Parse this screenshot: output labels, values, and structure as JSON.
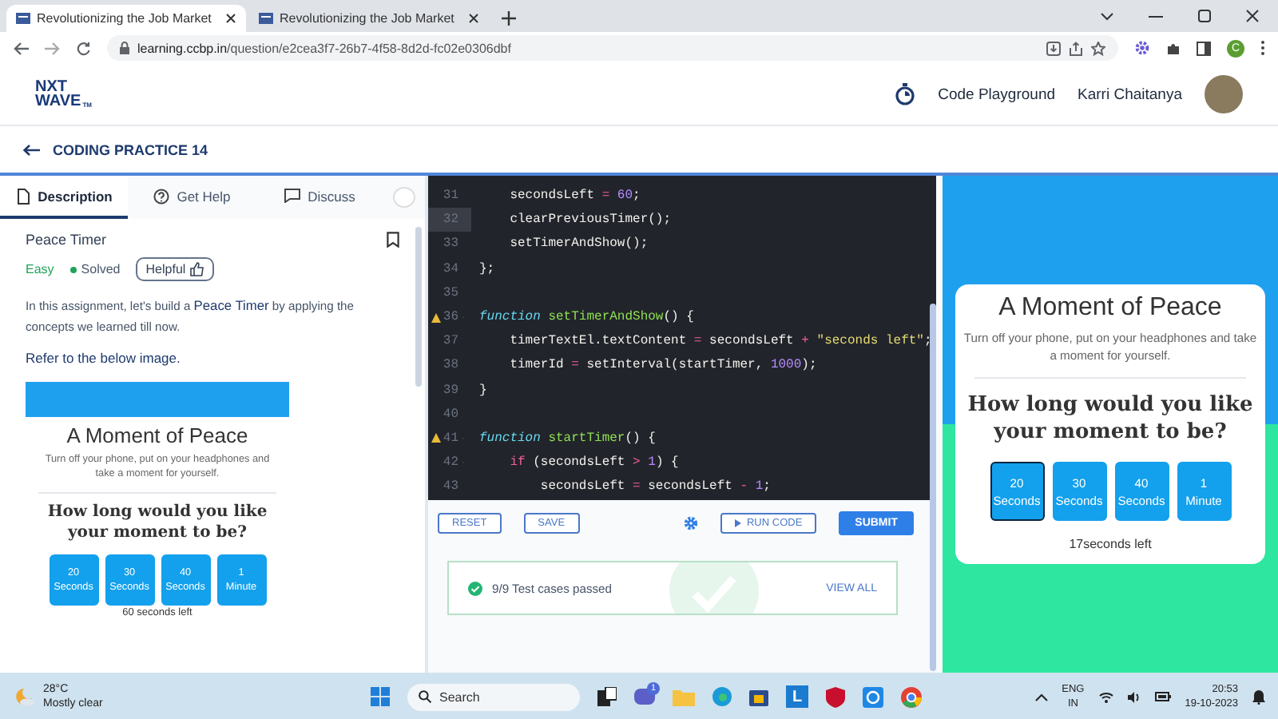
{
  "browser": {
    "tabs": [
      {
        "title": "Revolutionizing the Job Market",
        "selected": true
      },
      {
        "title": "Revolutionizing the Job Market",
        "selected": false
      }
    ],
    "url_host": "learning.ccbp.in",
    "url_path": "/question/e2cea3f7-26b7-4f58-8d2d-fc02e0306dbf",
    "profile_initial": "C"
  },
  "header": {
    "logo_top": "NXT",
    "logo_bottom": "WAVE",
    "logo_mark": "TM",
    "playground": "Code Playground",
    "user": "Karri Chaitanya"
  },
  "practice": {
    "title": "CODING PRACTICE 14"
  },
  "left_panel": {
    "tabs": [
      {
        "label": "Description",
        "selected": true
      },
      {
        "label": "Get Help",
        "selected": false
      },
      {
        "label": "Discuss",
        "selected": false
      }
    ],
    "problem": {
      "title": "Peace Timer",
      "difficulty": "Easy",
      "status": "Solved",
      "helpful": "Helpful"
    },
    "description": "In this assignment, let's build a **Peace Timer** by applying the concepts we learned till now.",
    "refer": "Refer to the below image.",
    "preview": {
      "title": "A Moment of Peace",
      "subtitle": "Turn off your phone, put on your headphones and take a moment for yourself.",
      "question": "How long would you like your moment to be?",
      "options": [
        {
          "value": "20",
          "unit": "Seconds",
          "selected": false
        },
        {
          "value": "30",
          "unit": "Seconds",
          "selected": false
        },
        {
          "value": "40",
          "unit": "Seconds",
          "selected": false
        },
        {
          "value": "1",
          "unit": "Minute",
          "selected": false
        }
      ],
      "timer": "60 seconds left"
    }
  },
  "editor": {
    "lines": [
      {
        "number": "31",
        "warning": false,
        "foldable": false,
        "highlighted": false,
        "tokens": [
          {
            "kind": "plain",
            "text": "    secondsLeft "
          },
          {
            "kind": "op",
            "text": "="
          },
          {
            "kind": "num",
            "text": " 60"
          },
          {
            "kind": "plain",
            "text": ";"
          }
        ]
      },
      {
        "number": "32",
        "warning": false,
        "foldable": false,
        "highlighted": true,
        "tokens": [
          {
            "kind": "plain",
            "text": "    clearPreviousTimer();"
          }
        ]
      },
      {
        "number": "33",
        "warning": false,
        "foldable": false,
        "highlighted": false,
        "tokens": [
          {
            "kind": "plain",
            "text": "    setTimerAndShow();"
          }
        ]
      },
      {
        "number": "34",
        "warning": false,
        "foldable": false,
        "highlighted": false,
        "tokens": [
          {
            "kind": "plain",
            "text": "};"
          }
        ]
      },
      {
        "number": "35",
        "warning": false,
        "foldable": false,
        "highlighted": false
      },
      {
        "number": "36",
        "warning": true,
        "foldable": true,
        "highlighted": false,
        "tokens": [
          {
            "kind": "kw",
            "text": "function"
          },
          {
            "kind": "fn",
            "text": " setTimerAndShow"
          },
          {
            "kind": "plain",
            "text": "() {"
          }
        ]
      },
      {
        "number": "37",
        "warning": false,
        "foldable": false,
        "highlighted": false,
        "tokens": [
          {
            "kind": "plain",
            "text": "    timerTextEl.textContent "
          },
          {
            "kind": "op",
            "text": "="
          },
          {
            "kind": "plain",
            "text": " secondsLeft "
          },
          {
            "kind": "op",
            "text": "+"
          },
          {
            "kind": "str",
            "text": " \"seconds left\""
          },
          {
            "kind": "plain",
            "text": ";"
          }
        ]
      },
      {
        "number": "38",
        "warning": false,
        "foldable": false,
        "highlighted": false,
        "tokens": [
          {
            "kind": "plain",
            "text": "    timerId "
          },
          {
            "kind": "op",
            "text": "="
          },
          {
            "kind": "plain",
            "text": " setInterval(startTimer, "
          },
          {
            "kind": "num",
            "text": "1000"
          },
          {
            "kind": "plain",
            "text": ");"
          }
        ]
      },
      {
        "number": "39",
        "warning": false,
        "foldable": false,
        "highlighted": false,
        "tokens": [
          {
            "kind": "plain",
            "text": "}"
          }
        ]
      },
      {
        "number": "40",
        "warning": false,
        "foldable": false,
        "highlighted": false
      },
      {
        "number": "41",
        "warning": true,
        "foldable": true,
        "highlighted": false,
        "tokens": [
          {
            "kind": "kw",
            "text": "function"
          },
          {
            "kind": "fn",
            "text": " startTimer"
          },
          {
            "kind": "plain",
            "text": "() {"
          }
        ]
      },
      {
        "number": "42",
        "warning": false,
        "foldable": true,
        "highlighted": false,
        "tokens": [
          {
            "kind": "ctl",
            "text": "    if"
          },
          {
            "kind": "plain",
            "text": " (secondsLeft "
          },
          {
            "kind": "op",
            "text": ">"
          },
          {
            "kind": "num",
            "text": " 1"
          },
          {
            "kind": "plain",
            "text": ") {"
          }
        ]
      },
      {
        "number": "43",
        "warning": false,
        "foldable": false,
        "highlighted": false,
        "tokens": [
          {
            "kind": "plain",
            "text": "        secondsLeft "
          },
          {
            "kind": "op",
            "text": "="
          },
          {
            "kind": "plain",
            "text": " secondsLeft "
          },
          {
            "kind": "op",
            "text": "-"
          },
          {
            "kind": "num",
            "text": " 1"
          },
          {
            "kind": "plain",
            "text": ";"
          }
        ]
      }
    ],
    "reset": "RESET",
    "save": "SAVE",
    "run": "RUN CODE",
    "submit": "SUBMIT"
  },
  "test_results": {
    "summary": "9/9 Test cases passed",
    "link": "VIEW ALL"
  },
  "output_preview": {
    "title": "A Moment of Peace",
    "subtitle": "Turn off your phone, put on your headphones and take a moment for yourself.",
    "question": "How long would you like your moment to be?",
    "options": [
      {
        "value": "20",
        "unit": "Seconds",
        "selected": true
      },
      {
        "value": "30",
        "unit": "Seconds",
        "selected": false
      },
      {
        "value": "40",
        "unit": "Seconds",
        "selected": false
      },
      {
        "value": "1",
        "unit": "Minute",
        "selected": false
      }
    ],
    "timer": "17seconds left"
  },
  "taskbar": {
    "temperature": "28°C",
    "weather": "Mostly clear",
    "search": "Search",
    "chat_badge": "1",
    "l_app": "L",
    "language": "ENG",
    "region": "IN",
    "time": "20:53",
    "date": "19-10-2023"
  }
}
